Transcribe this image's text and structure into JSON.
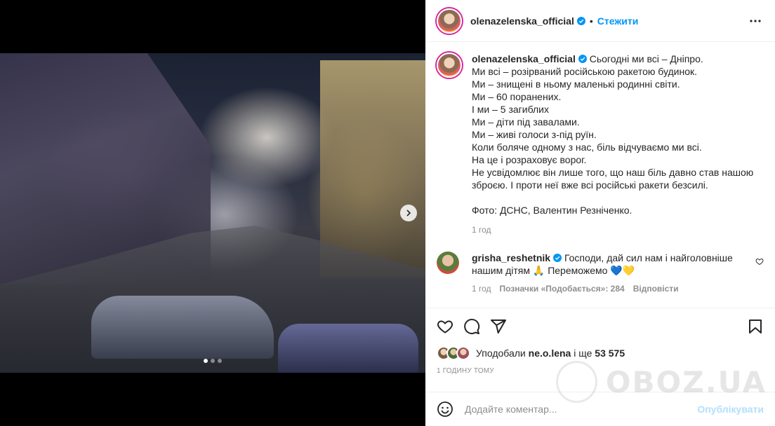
{
  "post": {
    "username": "olenazelenska_official",
    "separator": "•",
    "follow_label": "Стежити"
  },
  "caption": {
    "username": "olenazelenska_official",
    "lines": [
      "Сьогодні ми всі – Дніпро.",
      "Ми всі – розірваний російською ракетою будинок.",
      "Ми – знищені в ньому маленькі родинні світи.",
      "Ми – 60 поранених.",
      "І ми – 5 загиблих",
      "Ми – діти під завалами.",
      "Ми – живі голоси з-під руїн.",
      "Коли боляче одному з нас, біль відчуваємо ми всі.",
      "На це і розраховує ворог.",
      "Не усвідомлює він лише того, що наш біль давно став нашою зброєю. І проти неї вже всі російські ракети безсилі.",
      "",
      "Фото: ДСНС, Валентин Резніченко."
    ],
    "time": "1 год"
  },
  "comment": {
    "username": "grisha_reshetnik",
    "text": "Господи, дай сил нам і найголовніше нашим дітям 🙏 Переможемо 💙💛",
    "time": "1 год",
    "likes": "Позначки «Подобається»: 284",
    "reply": "Відповісти"
  },
  "likes": {
    "prefix": "Уподобали",
    "user": "ne.o.lena",
    "middle": "і ще",
    "count": "53 575"
  },
  "time_ago": "1 годину тому",
  "add_comment": {
    "placeholder": "Додайте коментар...",
    "publish": "Опублікувати"
  },
  "watermark": "OBOZ.UA",
  "carousel": {
    "total": 3,
    "active": 0
  },
  "colors": {
    "link": "#0095f6",
    "verified": "#0095f6",
    "publish_disabled": "#b2dffc",
    "muted": "#8e8e8e"
  }
}
